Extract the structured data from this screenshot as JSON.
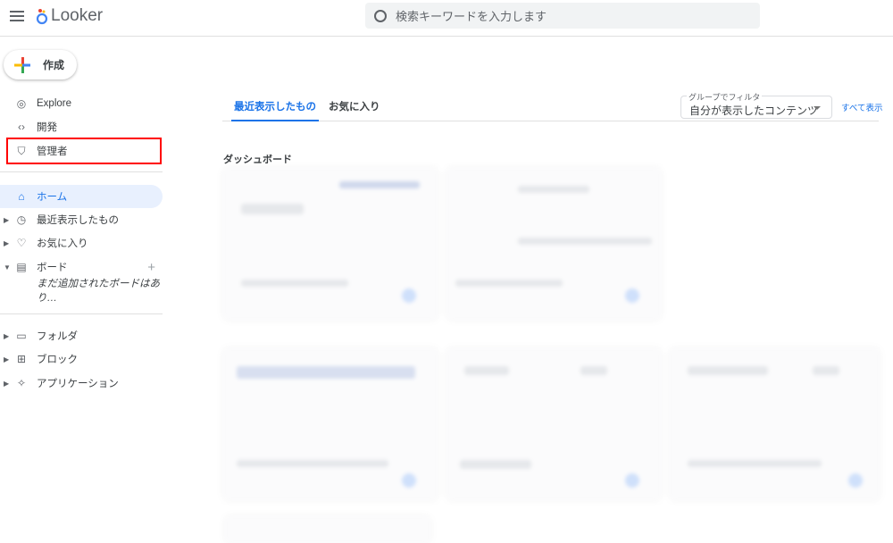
{
  "header": {
    "app_name": "Looker",
    "search_placeholder": "検索キーワードを入力します"
  },
  "sidebar": {
    "create_label": "作成",
    "top_items": [
      {
        "label": "Explore",
        "icon": "compass-icon"
      },
      {
        "label": "開発",
        "icon": "code-icon"
      },
      {
        "label": "管理者",
        "icon": "admin-shield-icon"
      }
    ],
    "items": [
      {
        "label": "ホーム",
        "icon": "home-icon"
      },
      {
        "label": "最近表示したもの",
        "icon": "clock-icon"
      },
      {
        "label": "お気に入り",
        "icon": "heart-icon"
      },
      {
        "label": "ボード",
        "icon": "clipboard-icon"
      }
    ],
    "boards_empty": "まだ追加されたボードはあり…",
    "bottom_items": [
      {
        "label": "フォルダ",
        "icon": "folder-icon"
      },
      {
        "label": "ブロック",
        "icon": "blocks-icon"
      },
      {
        "label": "アプリケーション",
        "icon": "puzzle-icon"
      }
    ]
  },
  "main": {
    "tabs": [
      {
        "label": "最近表示したもの"
      },
      {
        "label": "お気に入り"
      }
    ],
    "filter": {
      "label": "グループでフィルタ",
      "value": "自分が表示したコンテンツ"
    },
    "show_all": "すべて表示",
    "section_title": "ダッシュボード"
  },
  "colors": {
    "accent": "#1a73e8",
    "highlight": "#ff0000"
  }
}
